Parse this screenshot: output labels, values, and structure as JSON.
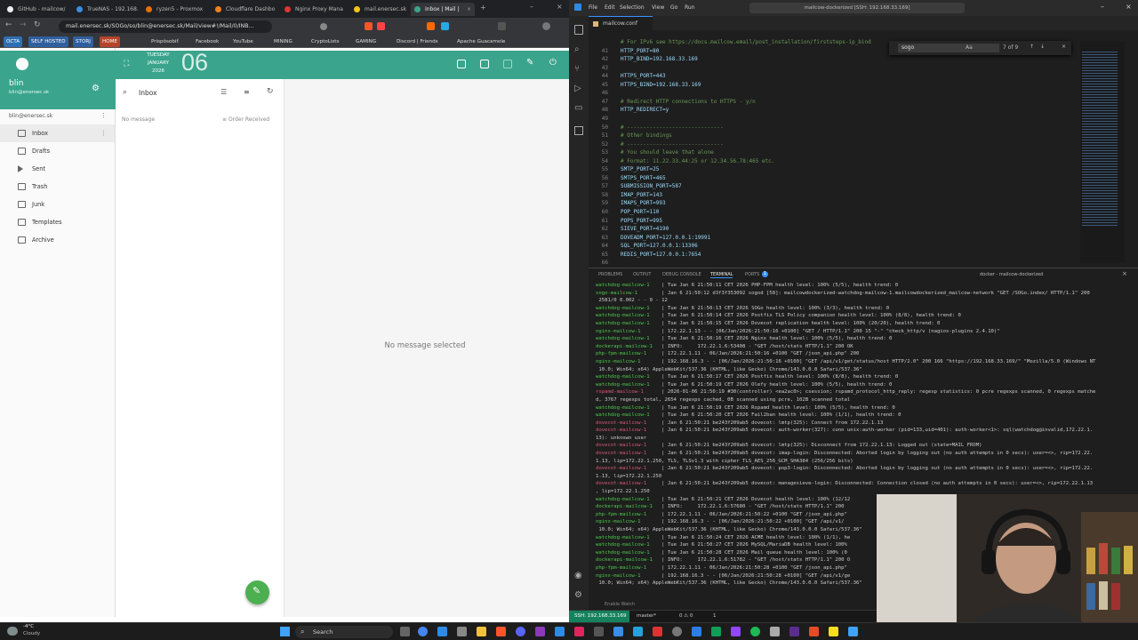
{
  "browser": {
    "tabs": [
      {
        "label": "GitHub - mailcow/",
        "active": false
      },
      {
        "label": "TrueNAS - 192.168.",
        "active": false
      },
      {
        "label": "ryzen5 - Proxmox",
        "active": false
      },
      {
        "label": "Cloudflare Dashbo",
        "active": false
      },
      {
        "label": "Nginx Proxy Mana",
        "active": false
      },
      {
        "label": "mail.enersec.sk",
        "active": false
      },
      {
        "label": "Inbox | Mail | ",
        "active": true
      }
    ],
    "url": "mail.enersec.sk/SOGo/so/blin@enersec.sk/Mail/view#!/Mail/0/INB...",
    "bookmarks": [
      "OCTA",
      "SELF HOSTED",
      "STORJ",
      "HOME",
      "Prispôsobiť",
      "Facebook",
      "YouTube",
      "MINING",
      "CryptoLists",
      "GAMING",
      "Discord | Friends",
      "Apache Guacamole"
    ]
  },
  "sogo": {
    "user_name": "blin",
    "user_email": "blin@enersec.sk",
    "account_label": "blin@enersec.sk",
    "date": {
      "weekday": "TUESDAY",
      "month": "JANUARY",
      "year": "2026",
      "day": "06"
    },
    "folders": [
      "Inbox",
      "Drafts",
      "Sent",
      "Trash",
      "Junk",
      "Templates",
      "Archive"
    ],
    "list_title": "Inbox",
    "no_message": "No message",
    "order_label": "Order Received",
    "no_selected": "No message selected"
  },
  "vscode": {
    "menu": [
      "File",
      "Edit",
      "Selection",
      "View",
      "Go",
      "Run"
    ],
    "title": "mailcow-dockerized [SSH: 192.168.33.169]",
    "tab": "mailcow.conf",
    "search_value": "sogo",
    "search_count": "7 of 9",
    "editor_lines": [
      {
        "n": "",
        "t": "# For IPv6 see https://docs.mailcow.email/post_installation/firststeps-ip_bind"
      },
      {
        "n": "41",
        "t": "HTTP_PORT=80"
      },
      {
        "n": "42",
        "t": "HTTP_BIND=192.168.33.169"
      },
      {
        "n": "43",
        "t": ""
      },
      {
        "n": "44",
        "t": "HTTPS_PORT=443"
      },
      {
        "n": "45",
        "t": "HTTPS_BIND=192.168.33.169"
      },
      {
        "n": "46",
        "t": ""
      },
      {
        "n": "47",
        "t": "# Redirect HTTP connections to HTTPS - y/n"
      },
      {
        "n": "48",
        "t": "HTTP_REDIRECT=y"
      },
      {
        "n": "49",
        "t": ""
      },
      {
        "n": "50",
        "t": "# ------------------------------"
      },
      {
        "n": "51",
        "t": "# Other bindings"
      },
      {
        "n": "52",
        "t": "# ------------------------------"
      },
      {
        "n": "53",
        "t": "# You should leave that alone"
      },
      {
        "n": "54",
        "t": "# Format: 11.22.33.44:25 or 12.34.56.78:465 etc."
      },
      {
        "n": "55",
        "t": "SMTP_PORT=25"
      },
      {
        "n": "56",
        "t": "SMTPS_PORT=465"
      },
      {
        "n": "57",
        "t": "SUBMISSION_PORT=587"
      },
      {
        "n": "58",
        "t": "IMAP_PORT=143"
      },
      {
        "n": "59",
        "t": "IMAPS_PORT=993"
      },
      {
        "n": "60",
        "t": "POP_PORT=110"
      },
      {
        "n": "61",
        "t": "POPS_PORT=995"
      },
      {
        "n": "62",
        "t": "SIEVE_PORT=4190"
      },
      {
        "n": "63",
        "t": "DOVEADM_PORT=127.0.0.1:19991"
      },
      {
        "n": "64",
        "t": "SQL_PORT=127.0.0.1:13306"
      },
      {
        "n": "65",
        "t": "REDIS_PORT=127.0.0.1:7654"
      },
      {
        "n": "66",
        "t": ""
      }
    ],
    "panel_tabs": [
      "PROBLEMS",
      "OUTPUT",
      "DEBUG CONSOLE",
      "TERMINAL",
      "PORTS"
    ],
    "ports_count": "1",
    "terminal_title": "docker - mailcow-dockerized",
    "terminal_lines": [
      {
        "s": "watchdog-mailcow-1",
        "c": "g",
        "m": "| Tue Jan 6 21:50:11 CET 2026 PHP-FPM health level: 100% (5/5), health trend: 0"
      },
      {
        "s": "sogo-mailcow-1",
        "c": "g",
        "m": "| Jan 6 21:50:12 d3f3f353092 sogod [58]: mailcowdockerized-watchdog-mailcow-1.mailcowdockerized_mailcow-network \"GET /SOGo.index/ HTTP/1.1\" 200"
      },
      {
        "s": "",
        "c": "",
        "m": " 2581/0 0.002 - - 0 - 12"
      },
      {
        "s": "watchdog-mailcow-1",
        "c": "g",
        "m": "| Tue Jan 6 21:50:13 CET 2026 SOGo health level: 100% (3/3), health trend: 0"
      },
      {
        "s": "watchdog-mailcow-1",
        "c": "g",
        "m": "| Tue Jan 6 21:50:14 CET 2026 Postfix TLS Policy companion health level: 100% (8/8), health trend: 0"
      },
      {
        "s": "watchdog-mailcow-1",
        "c": "g",
        "m": "| Tue Jan 6 21:50:15 CET 2026 Dovecot replication health level: 100% (20/20), health trend: 0"
      },
      {
        "s": "nginx-mailcow-1",
        "c": "g",
        "m": "| 172.22.1.13 - - [06/Jan/2026:21:50:16 +0100] \"GET / HTTP/1.1\" 200 15 \"-\" \"check_http/v (nagios-plugins 2.4.10)\""
      },
      {
        "s": "watchdog-mailcow-1",
        "c": "g",
        "m": "| Tue Jan 6 21:50:16 CET 2026 Nginx health level: 100% (5/5), health trend: 0"
      },
      {
        "s": "dockerapi-mailcow-1",
        "c": "g",
        "m": "| INFO:     172.22.1.6:53408 - \"GET /host/stats HTTP/1.1\" 200 OK"
      },
      {
        "s": "php-fpm-mailcow-1",
        "c": "g",
        "m": "| 172.22.1.11 - 06/Jan/2026:21:50:16 +0100 \"GET /json_api.php\" 200"
      },
      {
        "s": "nginx-mailcow-1",
        "c": "g",
        "m": "| 192.168.16.3 - - [06/Jan/2026:21:50:16 +0100] \"GET /api/v1/get/status/host HTTP/2.0\" 200 166 \"https://192.168.33.169/\" \"Mozilla/5.0 (Windows NT"
      },
      {
        "s": "",
        "c": "",
        "m": " 10.0; Win64; x64) AppleWebKit/537.36 (KHTML, like Gecko) Chrome/143.0.0.0 Safari/537.36\""
      },
      {
        "s": "watchdog-mailcow-1",
        "c": "g",
        "m": "| Tue Jan 6 21:50:17 CET 2026 Postfix health level: 100% (8/8), health trend: 0"
      },
      {
        "s": "watchdog-mailcow-1",
        "c": "g",
        "m": "| Tue Jan 6 21:50:19 CET 2026 Olefy health level: 100% (5/5), health trend: 0"
      },
      {
        "s": "rspamd-mailcow-1",
        "c": "r",
        "m": "| 2026-01-06 21:50:19 #30(controller) <ea2ac0>; csession; rspamd_protocol_http_reply: regexp statistics: 0 pcre regexps scanned, 0 regexps matche"
      },
      {
        "s": "",
        "c": "",
        "m": "d, 3767 regexps total, 2654 regexps cached, 0B scanned using pcre, 102B scanned total"
      },
      {
        "s": "watchdog-mailcow-1",
        "c": "g",
        "m": "| Tue Jan 6 21:50:19 CET 2026 Rspamd health level: 100% (5/5), health trend: 0"
      },
      {
        "s": "watchdog-mailcow-1",
        "c": "g",
        "m": "| Tue Jan 6 21:50:20 CET 2026 Fail2ban health level: 100% (1/1), health trend: 0"
      },
      {
        "s": "dovecot-mailcow-1",
        "c": "r",
        "m": "| Jan 6 21:50:21 be243f209ab5 dovecot: lmtp(325): Connect from 172.22.1.13"
      },
      {
        "s": "dovecot-mailcow-1",
        "c": "r",
        "m": "| Jan 6 21:50:21 be243f209ab5 dovecot: auth-worker(327): conn unix:auth-worker (pid=133,uid=401): auth-worker<1>: sql(watchdog@invalid,172.22.1."
      },
      {
        "s": "",
        "c": "",
        "m": "13): unknown user"
      },
      {
        "s": "dovecot-mailcow-1",
        "c": "r",
        "m": "| Jan 6 21:50:21 be243f209ab5 dovecot: lmtp(325): Disconnect from 172.22.1.13: Logged out (state=MAIL FROM)"
      },
      {
        "s": "dovecot-mailcow-1",
        "c": "r",
        "m": "| Jan 6 21:50:21 be243f209ab5 dovecot: imap-login: Disconnected: Aborted login by logging out (no auth attempts in 0 secs): user=<>, rip=172.22."
      },
      {
        "s": "",
        "c": "",
        "m": "1.13, lip=172.22.1.250, TLS, TLSv1.3 with cipher TLS_AES_256_GCM_SHA384 (256/256 bits)"
      },
      {
        "s": "dovecot-mailcow-1",
        "c": "r",
        "m": "| Jan 6 21:50:21 be243f209ab5 dovecot: pop3-login: Disconnected: Aborted login by logging out (no auth attempts in 0 secs): user=<>, rip=172.22."
      },
      {
        "s": "",
        "c": "",
        "m": "1.13, lip=172.22.1.250"
      },
      {
        "s": "dovecot-mailcow-1",
        "c": "r",
        "m": "| Jan 6 21:50:21 be243f209ab5 dovecot: managesieve-login: Disconnected: Connection closed (no auth attempts in 0 secs): user=<>, rip=172.22.1.13"
      },
      {
        "s": "",
        "c": "",
        "m": ", lip=172.22.1.250"
      },
      {
        "s": "watchdog-mailcow-1",
        "c": "g",
        "m": "| Tue Jan 6 21:50:21 CET 2026 Dovecot health level: 100% (12/12"
      },
      {
        "s": "dockerapi-mailcow-1",
        "c": "g",
        "m": "| INFO:     172.22.1.6:57680 - \"GET /host/stats HTTP/1.1\" 200"
      },
      {
        "s": "php-fpm-mailcow-1",
        "c": "g",
        "m": "| 172.22.1.11 - 06/Jan/2026:21:50:22 +0100 \"GET /json_api.php\""
      },
      {
        "s": "nginx-mailcow-1",
        "c": "g",
        "m": "| 192.168.16.3 - - [06/Jan/2026:21:50:22 +0100] \"GET /api/v1/"
      },
      {
        "s": "",
        "c": "",
        "m": " 10.0; Win64; x64) AppleWebKit/537.36 (KHTML, like Gecko) Chrome/143.0.0.0 Safari/537.36\""
      },
      {
        "s": "watchdog-mailcow-1",
        "c": "g",
        "m": "| Tue Jan 6 21:50:24 CET 2026 ACME health level: 100% (1/1), he"
      },
      {
        "s": "watchdog-mailcow-1",
        "c": "g",
        "m": "| Tue Jan 6 21:50:27 CET 2026 MySQL/MariaDB health level: 100%"
      },
      {
        "s": "watchdog-mailcow-1",
        "c": "g",
        "m": "| Tue Jan 6 21:50:28 CET 2026 Mail queue health level: 100% (0"
      },
      {
        "s": "dockerapi-mailcow-1",
        "c": "g",
        "m": "| INFO:     172.22.1.6:51782 - \"GET /host/stats HTTP/1.1\" 200 O"
      },
      {
        "s": "php-fpm-mailcow-1",
        "c": "g",
        "m": "| 172.22.1.11 - 06/Jan/2026:21:50:28 +0100 \"GET /json_api.php\""
      },
      {
        "s": "nginx-mailcow-1",
        "c": "g",
        "m": "| 192.168.16.3 - - [06/Jan/2026:21:50:28 +0100] \"GET /api/v1/ge"
      },
      {
        "s": "",
        "c": "",
        "m": " 10.0; Win64; x64) AppleWebKit/537.36 (KHTML, like Gecko) Chrome/143.0.0.0 Safari/537.36\""
      }
    ],
    "enable_watch": "Enable Watch",
    "status_ssh": "SSH: 192.168.33.169",
    "status_branch": "master*",
    "status_errors": "0 ⚠ 0",
    "status_ports": "1"
  },
  "taskbar": {
    "weather_temp": "-4°C",
    "weather_desc": "Cloudy",
    "search_placeholder": "Search"
  }
}
